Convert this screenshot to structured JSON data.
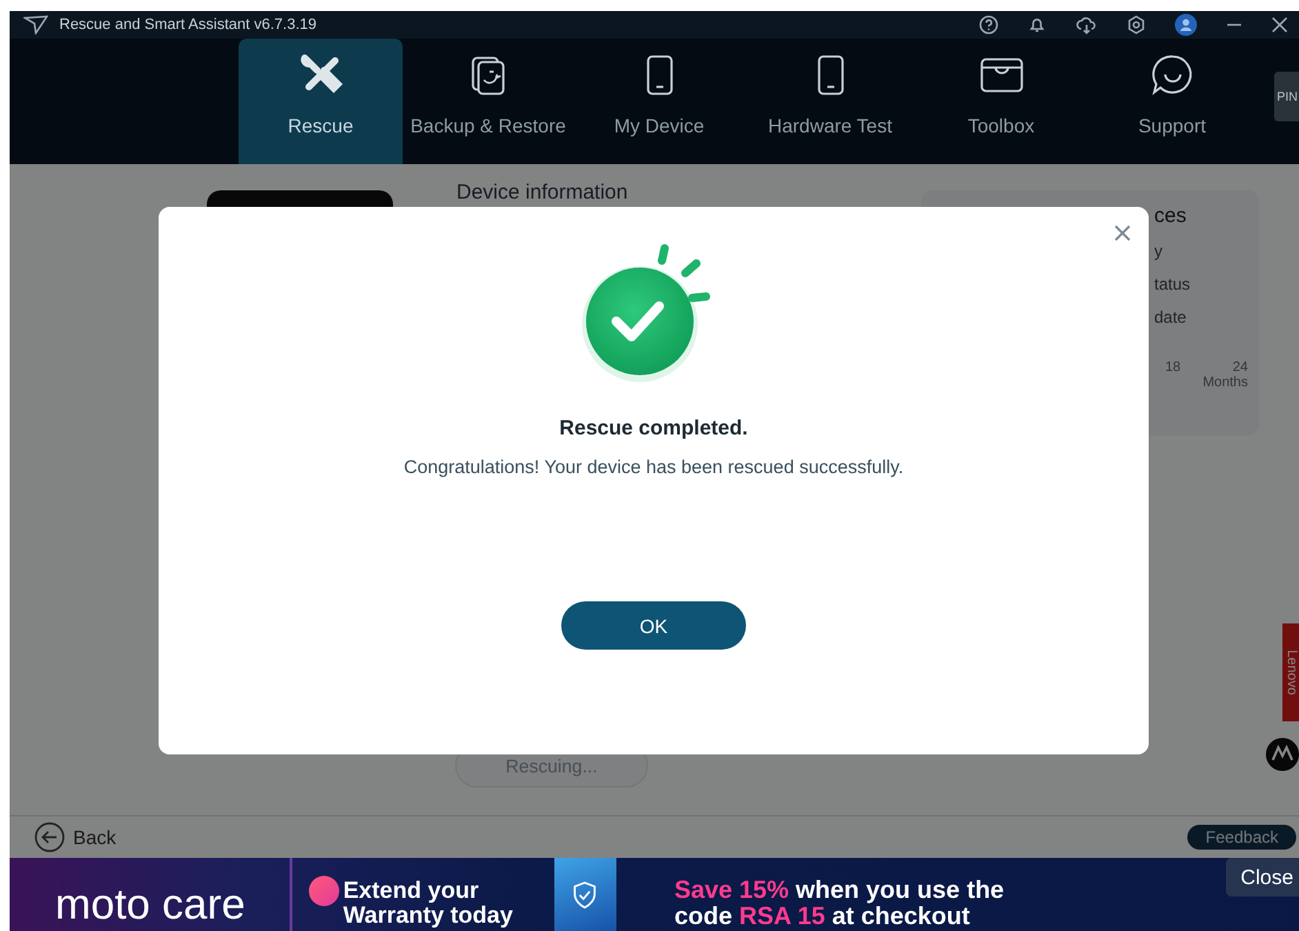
{
  "window": {
    "title": "Rescue and Smart Assistant v6.7.3.19"
  },
  "nav": {
    "tabs": [
      {
        "label": "Rescue",
        "selected": true
      },
      {
        "label": "Backup & Restore",
        "selected": false
      },
      {
        "label": "My Device",
        "selected": false
      },
      {
        "label": "Hardware Test",
        "selected": false
      },
      {
        "label": "Toolbox",
        "selected": false
      },
      {
        "label": "Support",
        "selected": false
      }
    ],
    "pin_button": "PIN"
  },
  "device_info": {
    "title": "Device information"
  },
  "info_card": {
    "title": "ces",
    "lines": [
      "y",
      "tatus",
      "date"
    ],
    "ticks": [
      "18",
      "24"
    ],
    "unit": "Months"
  },
  "progress_button": {
    "label": "Rescuing...",
    "disabled": true
  },
  "back": "Back",
  "feedback": "Feedback",
  "side_logo": "Lenovo",
  "dialog": {
    "title": "Rescue completed.",
    "message": "Congratulations! Your device has been rescued successfully.",
    "ok_button": "OK"
  },
  "banner": {
    "brand": "moto care",
    "headline": [
      "Extend your",
      "Warranty today"
    ],
    "offer": [
      [
        {
          "text": "Save 15%",
          "highlight": true
        },
        {
          "text": " when you use the",
          "highlight": false
        }
      ],
      [
        {
          "text": "code ",
          "highlight": false
        },
        {
          "text": "RSA 15",
          "highlight": true
        },
        {
          "text": " at checkout",
          "highlight": false
        }
      ]
    ],
    "close_button": "Close"
  }
}
